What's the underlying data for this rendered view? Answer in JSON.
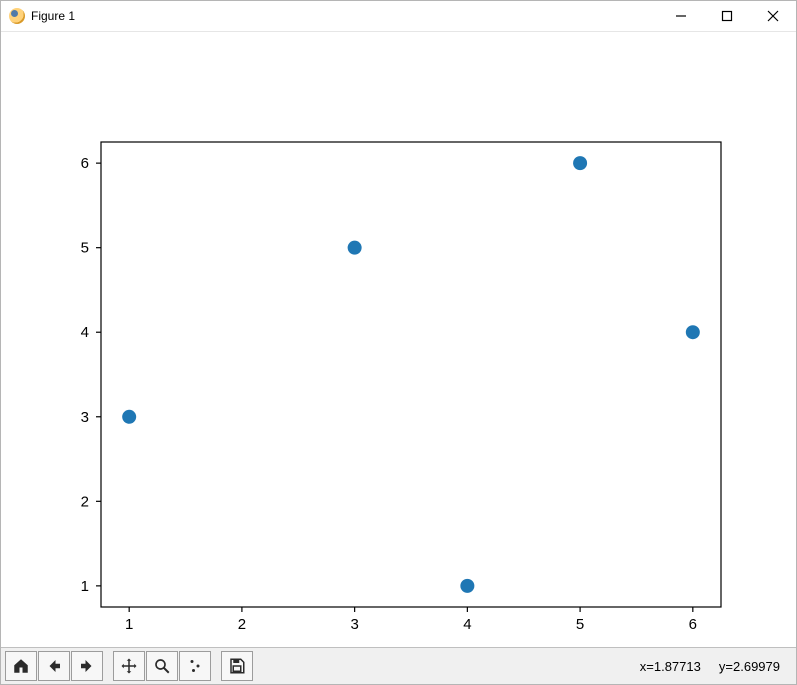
{
  "window": {
    "title": "Figure 1"
  },
  "toolbar": {
    "coord_text": "x=1.87713     y=2.69979"
  },
  "chart_data": {
    "type": "scatter",
    "x": [
      1,
      3,
      4,
      5,
      6
    ],
    "y": [
      3,
      5,
      1,
      6,
      4
    ],
    "title": "",
    "xlabel": "",
    "ylabel": "",
    "xlim": [
      0.75,
      6.25
    ],
    "ylim": [
      0.75,
      6.25
    ],
    "xticks": [
      1,
      2,
      3,
      4,
      5,
      6
    ],
    "yticks": [
      1,
      2,
      3,
      4,
      5,
      6
    ],
    "series_color": "#1f77b4"
  }
}
